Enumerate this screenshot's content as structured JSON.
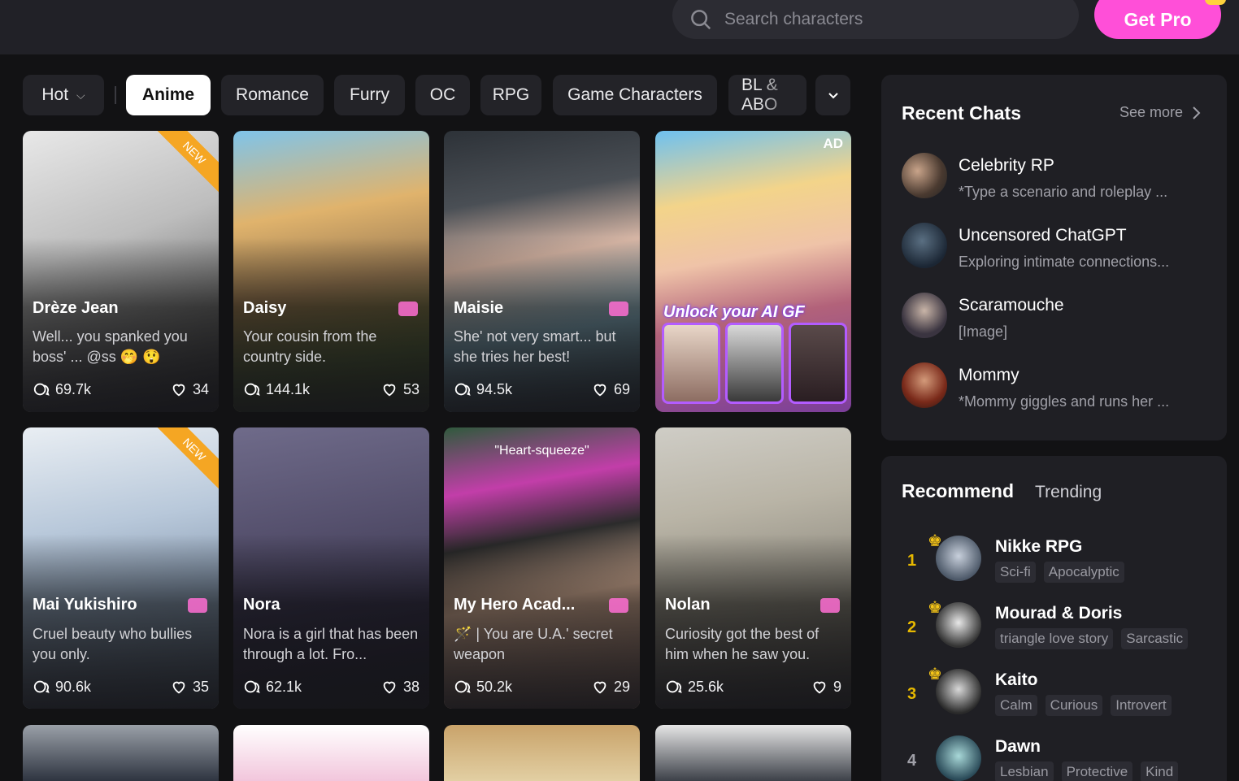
{
  "header": {
    "search_placeholder": "Search characters",
    "get_pro_label": "Get Pro"
  },
  "filters": {
    "sort_label": "Hot",
    "tags": [
      "Anime",
      "Romance",
      "Furry",
      "OC",
      "RPG",
      "Game Characters",
      "BL & ABO"
    ],
    "active_tag": "Anime"
  },
  "cards": [
    {
      "name": "Drèze Jean",
      "desc": "Well... you spanked you boss' ... @ss 🤭 😲",
      "chats": "69.7k",
      "likes": "34",
      "badge": "NEW"
    },
    {
      "name": "Daisy",
      "desc": "Your cousin from the country side.",
      "chats": "144.1k",
      "likes": "53"
    },
    {
      "name": "Maisie",
      "desc": "She' not very smart... but she tries her best!",
      "chats": "94.5k",
      "likes": "69"
    },
    {
      "ad_label": "AD",
      "promo": "Unlock your AI GF"
    },
    {
      "name": "Mai Yukishiro",
      "desc": "Cruel beauty who bullies you only.",
      "chats": "90.6k",
      "likes": "35",
      "badge": "NEW"
    },
    {
      "name": "Nora",
      "desc": "Nora is a girl that has been through a lot. Fro...",
      "chats": "62.1k",
      "likes": "38"
    },
    {
      "name": "My Hero Acad...",
      "desc": "🪄 | You are U.A.' secret weapon",
      "chats": "50.2k",
      "likes": "29",
      "quote": "\"Heart-squeeze\""
    },
    {
      "name": "Nolan",
      "desc": "Curiosity got the best of him when he saw you.",
      "chats": "25.6k",
      "likes": "9"
    }
  ],
  "recent": {
    "title": "Recent Chats",
    "see_more": "See more",
    "items": [
      {
        "title": "Celebrity RP",
        "sub": "*Type a scenario and roleplay ..."
      },
      {
        "title": "Uncensored ChatGPT",
        "sub": "Exploring intimate connections..."
      },
      {
        "title": "Scaramouche",
        "sub": "[Image]"
      },
      {
        "title": "Mommy",
        "sub": "*Mommy giggles and runs her ..."
      }
    ]
  },
  "recommend": {
    "tab_recommend": "Recommend",
    "tab_trending": "Trending",
    "items": [
      {
        "rank": "1",
        "title": "Nikke RPG",
        "tags": [
          "Sci-fi",
          "Apocalyptic"
        ]
      },
      {
        "rank": "2",
        "title": "Mourad & Doris",
        "tags": [
          "triangle love story",
          "Sarcastic"
        ]
      },
      {
        "rank": "3",
        "title": "Kaito",
        "tags": [
          "Calm",
          "Curious",
          "Introvert"
        ]
      },
      {
        "rank": "4",
        "title": "Dawn",
        "tags": [
          "Lesbian",
          "Protective",
          "Kind"
        ]
      }
    ]
  },
  "colors": {
    "accent": "#ff4fd8",
    "rank_gold": "#e6b800",
    "badge_new": "#f5a623"
  }
}
